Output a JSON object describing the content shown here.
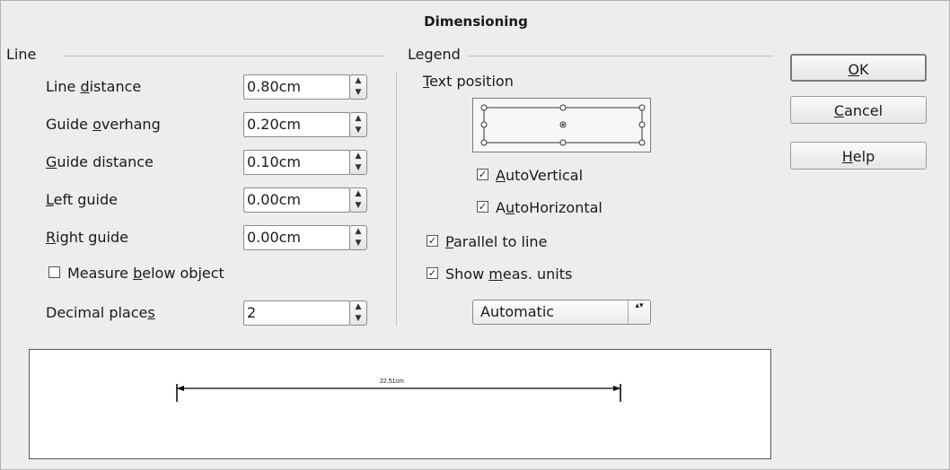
{
  "dialog": {
    "title": "Dimensioning"
  },
  "line_section": {
    "label": "Line",
    "fields": [
      {
        "pre": "Line ",
        "key": "d",
        "post": "istance",
        "value": "0.80cm"
      },
      {
        "pre": "Guide ",
        "key": "o",
        "post": "verhang",
        "value": "0.20cm"
      },
      {
        "pre": "",
        "key": "G",
        "post": "uide distance",
        "value": "0.10cm"
      },
      {
        "pre": "",
        "key": "L",
        "post": "eft guide",
        "value": "0.00cm"
      },
      {
        "pre": "",
        "key": "R",
        "post": "ight guide",
        "value": "0.00cm"
      }
    ],
    "measure_below": {
      "pre": "Measure ",
      "key": "b",
      "post": "elow object",
      "checked": false
    },
    "decimal_places": {
      "pre": "Decimal place",
      "key": "s",
      "post": "",
      "value": "2"
    }
  },
  "legend_section": {
    "label": "Legend",
    "text_position": {
      "pre": "",
      "key": "T",
      "post": "ext position"
    },
    "auto_vertical": {
      "pre": "",
      "key": "A",
      "post": "utoVertical",
      "checked": true
    },
    "auto_horizontal": {
      "pre": "A",
      "key": "u",
      "post": "toHorizontal",
      "checked": true
    },
    "parallel": {
      "pre": "",
      "key": "P",
      "post": "arallel to line",
      "checked": true
    },
    "show_units": {
      "pre": "Show ",
      "key": "m",
      "post": "eas. units",
      "checked": true
    },
    "units_select": "Automatic"
  },
  "buttons": {
    "ok": {
      "pre": "",
      "key": "O",
      "post": "K"
    },
    "cancel": {
      "pre": "",
      "key": "C",
      "post": "ancel"
    },
    "help": {
      "pre": "",
      "key": "H",
      "post": "elp"
    }
  },
  "preview": {
    "measurement": "22.51cm"
  },
  "icons": {
    "spin": "spin-updown-icon",
    "check": "checkmark-icon",
    "radio": "radio-icon"
  }
}
